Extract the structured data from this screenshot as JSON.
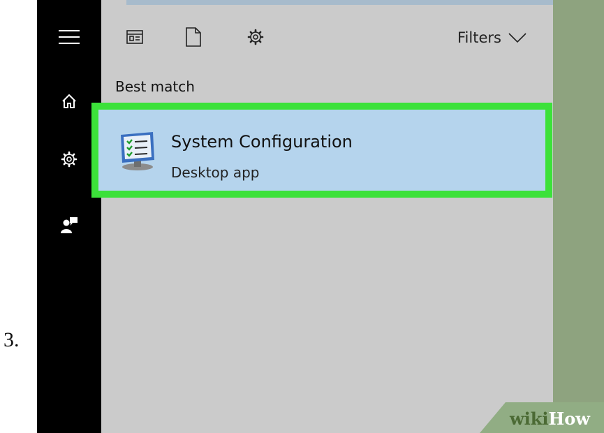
{
  "step": {
    "number": "3."
  },
  "sidebar": {
    "icons": [
      "hamburger-menu-icon",
      "home-icon",
      "gear-icon",
      "feedback-icon"
    ]
  },
  "toolbar": {
    "icons": [
      "apps-icon",
      "documents-icon",
      "settings-icon"
    ],
    "filters_label": "Filters"
  },
  "results": {
    "section_label": "Best match",
    "best_match": {
      "title": "System Configuration",
      "subtitle": "Desktop app",
      "icon": "system-configuration-icon"
    }
  },
  "watermark": {
    "part1": "wiki",
    "part2": "How"
  },
  "colors": {
    "sidebar": "#000000",
    "panel": "#cbcbcb",
    "selection": "#b5d4ed",
    "highlight_border": "#3ce13a",
    "right_area": "#8ea37f"
  }
}
